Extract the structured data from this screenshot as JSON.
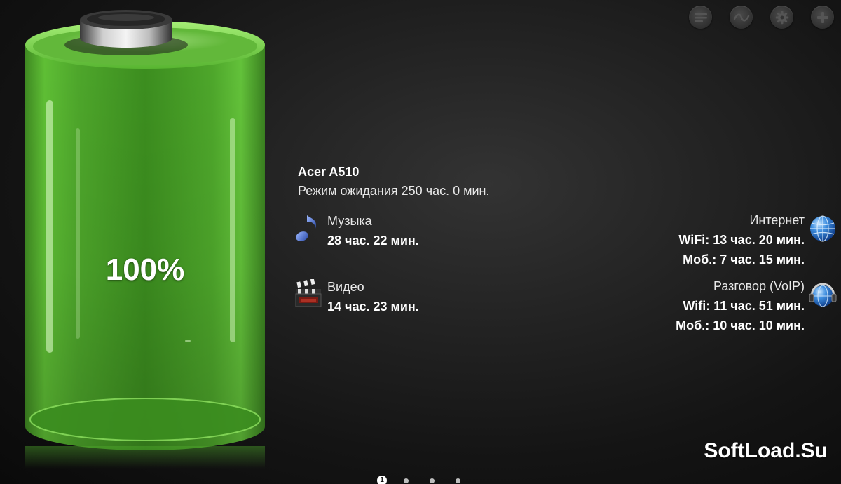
{
  "toolbar": {
    "buttons": [
      {
        "name": "list-icon"
      },
      {
        "name": "graph-icon"
      },
      {
        "name": "gear-icon"
      },
      {
        "name": "plus-icon"
      }
    ]
  },
  "battery": {
    "level": 1.0,
    "level_text": "100%",
    "fill_color": "#5ec13a"
  },
  "device": {
    "name": "Acer A510",
    "standby": "Режим ожидания 250 час. 0 мин."
  },
  "music": {
    "label": "Музыка",
    "time": "28 час. 22 мин.",
    "icon": "music-note-icon"
  },
  "video": {
    "label": "Видео",
    "time": "14 час. 23 мин.",
    "icon": "clapperboard-icon"
  },
  "internet": {
    "label": "Интернет",
    "wifi": "WiFi: 13 час. 20 мин.",
    "mobile": "Моб.: 7 час. 15 мин.",
    "icon": "globe-icon"
  },
  "voip": {
    "label": "Разговор (VoIP)",
    "wifi": "Wifi: 11 час. 51 мин.",
    "mobile": "Моб.: 10 час. 10 мин.",
    "icon": "headset-globe-icon"
  },
  "watermark": "SoftLoad.Su",
  "pager": {
    "active_label": "1",
    "total": 4,
    "active_index": 0
  }
}
